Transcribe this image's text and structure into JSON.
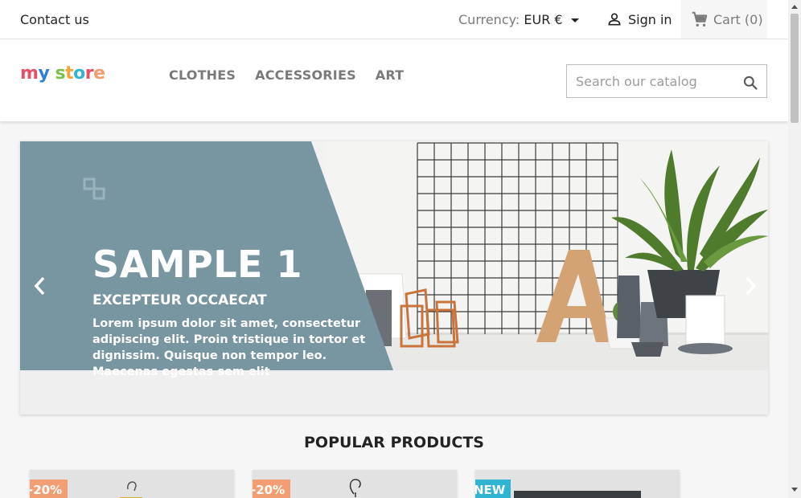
{
  "topbar": {
    "contact_label": "Contact us",
    "currency_label": "Currency:",
    "currency_value": "EUR €",
    "signin_label": "Sign in",
    "cart_label": "Cart",
    "cart_count": "(0)"
  },
  "header": {
    "logo_letters": [
      "m",
      "y",
      " ",
      "s",
      "t",
      "o",
      "r",
      "e"
    ],
    "logo_colors": [
      "#e94f64",
      "#2f7fd9",
      "#ffffff",
      "#7bc04a",
      "#f3a33b",
      "#2fb5d2",
      "#e94f64",
      "#f39d72"
    ],
    "menu": [
      "CLOTHES",
      "ACCESSORIES",
      "ART"
    ],
    "search_placeholder": "Search our catalog"
  },
  "slider": {
    "title": "SAMPLE 1",
    "subtitle": "EXCEPTEUR OCCAECAT",
    "description": "Lorem ipsum dolor sit amet, consectetur adipiscing elit. Proin tristique in tortor et dignissim. Quisque non tempor leo. Maecenas egestas sem elit",
    "panel_color": "#7895a2"
  },
  "popular": {
    "title": "POPULAR PRODUCTS",
    "products": [
      {
        "flag": "-20%",
        "flag_type": "discount"
      },
      {
        "flag": "-20%",
        "flag_type": "discount"
      },
      {
        "flag": "NEW",
        "flag_type": "new"
      }
    ]
  },
  "colors": {
    "discount": "#f39d72",
    "new": "#2fb5d2",
    "text": "#232323",
    "muted": "#7a7a7a"
  }
}
